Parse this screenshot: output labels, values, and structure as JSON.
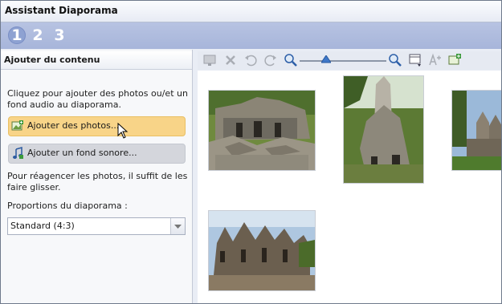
{
  "window": {
    "title": "Assistant Diaporama"
  },
  "steps": [
    {
      "label": "1",
      "active": true
    },
    {
      "label": "2",
      "active": false
    },
    {
      "label": "3",
      "active": false
    }
  ],
  "panel": {
    "title": "Ajouter du contenu",
    "instructions_line1": "Cliquez pour ajouter des photos ou/et un",
    "instructions_line2": "fond audio au diaporama.",
    "add_photos_label": "Ajouter des photos...",
    "add_audio_label": "Ajouter un fond sonore...",
    "reorder_line1": "Pour réagencer les photos, il suffit de les",
    "reorder_line2": "faire glisser.",
    "proportions_label": "Proportions du diaporama :",
    "proportions_value": "Standard (4:3)"
  },
  "toolbar": {
    "icons": [
      "monitor-icon",
      "delete-icon",
      "rotate-left-icon",
      "rotate-right-icon",
      "zoom-out-icon",
      "zoom-slider",
      "zoom-in-icon",
      "view-options-icon",
      "text-icon",
      "add-photo-icon"
    ],
    "zoom_level": 0.42
  },
  "gallery": {
    "photos": [
      {
        "name": "ruins-1"
      },
      {
        "name": "tree-temple"
      },
      {
        "name": "temple-towers-right"
      },
      {
        "name": "bayon-temple"
      }
    ]
  },
  "colors": {
    "accent": "#f8d488",
    "steps_bar": "#a7b5da"
  }
}
